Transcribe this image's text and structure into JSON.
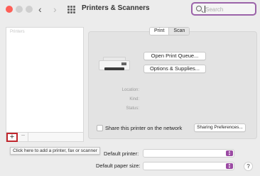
{
  "window": {
    "title": "Printers & Scanners",
    "back_glyph": "‹",
    "forward_glyph": "›"
  },
  "search": {
    "placeholder": "Search",
    "value": ""
  },
  "printers_list": {
    "header": "Printers",
    "add_glyph": "+",
    "remove_glyph": "−"
  },
  "tabs": [
    {
      "label": "Print",
      "selected": true
    },
    {
      "label": "Scan",
      "selected": false
    }
  ],
  "buttons": {
    "open_queue": "Open Print Queue...",
    "options_supplies": "Options & Supplies...",
    "sharing_prefs": "Sharing Preferences..."
  },
  "info": {
    "location_label": "Location:",
    "kind_label": "Kind:",
    "status_label": "Status:"
  },
  "share": {
    "label": "Share this printer on the network",
    "checked": false
  },
  "tooltip": "Click here to add a printer, fax or scanner",
  "defaults": {
    "printer_label": "Default printer:",
    "printer_value": "",
    "paper_label": "Default paper size:",
    "paper_value": ""
  },
  "help_glyph": "?",
  "colors": {
    "close": "#fe5f57",
    "accent": "#9b63a9",
    "select_arrow": "#9b4aa3",
    "highlight": "#c0262d"
  },
  "icons": [
    "back-icon",
    "forward-icon",
    "grid-icon",
    "search-icon",
    "printer-icon",
    "select-arrows-icon",
    "help-icon"
  ]
}
